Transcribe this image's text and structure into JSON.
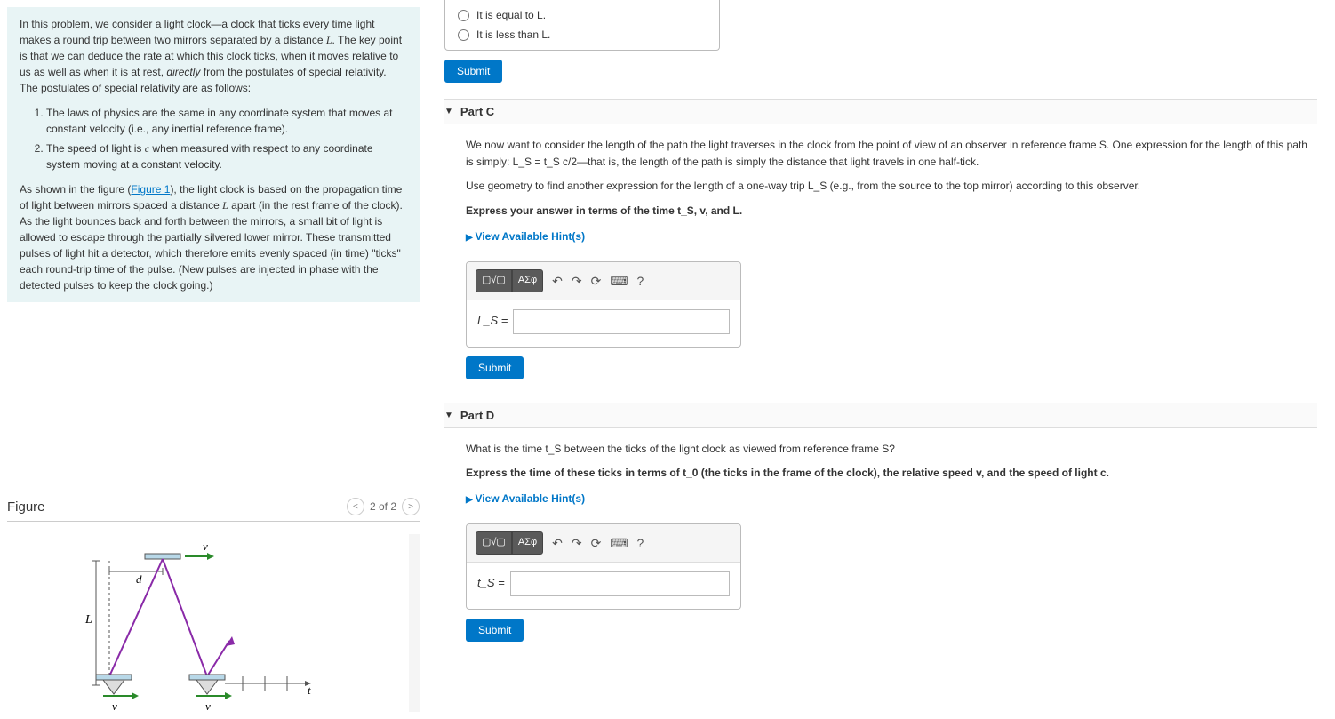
{
  "intro": {
    "p1a": "In this problem, we consider a light clock—a clock that ticks every time light makes a round trip between two mirrors separated by a distance ",
    "p1b": ". The key point is that we can deduce the rate at which this clock ticks, when it moves relative to us as well as when it is at rest, ",
    "p1c": " from the postulates of special relativity. The postulates of special relativity are as follows:",
    "p1_directly": "directly",
    "li1": "The laws of physics are the same in any coordinate system that moves at constant velocity (i.e., any inertial reference frame).",
    "li2a": "The speed of light is ",
    "li2b": " when measured with respect to any coordinate system moving at a constant velocity.",
    "p2a": "As shown in the figure (",
    "p2_link": "Figure 1",
    "p2b": "), the light clock is based on the propagation time of light between mirrors spaced a distance ",
    "p2c": " apart (in the rest frame of the clock). As the light bounces back and forth between the mirrors, a small bit of light is allowed to escape through the partially silvered lower mirror. These transmitted pulses of light hit a detector, which therefore emits evenly spaced (in time) \"ticks\" each round-trip time of the pulse. (New pulses are injected in phase with the detected pulses to keep the clock going.)",
    "varL": "L",
    "varc": "c"
  },
  "figure": {
    "title": "Figure",
    "pager": "2 of 2"
  },
  "partPrev": {
    "opt1": "It is equal to L.",
    "opt2": "It is less than L.",
    "submit": "Submit"
  },
  "partC": {
    "title": "Part C",
    "p1": "We now want to consider the length of the path the light traverses in the clock from the point of view of an observer in reference frame S. One expression for the length of this path is simply: L_S = t_S c/2—that is, the length of the path is simply the distance that light travels in one half-tick.",
    "p2": "Use geometry to find another expression for the length of a one-way trip L_S (e.g., from the source to the top mirror) according to this observer.",
    "instruct": "Express your answer in terms of the time t_S, v, and L.",
    "hints": "View Available Hint(s)",
    "label": "L_S =",
    "submit": "Submit"
  },
  "partD": {
    "title": "Part D",
    "p1": "What is the time t_S between the ticks of the light clock as viewed from reference frame S?",
    "instruct": "Express the time of these ticks in terms of t_0 (the ticks in the frame of the clock), the relative speed v, and the speed of light c.",
    "hints": "View Available Hint(s)",
    "label": "t_S =",
    "submit": "Submit"
  },
  "toolbar": {
    "templates": "▢√▢",
    "greek": "ΑΣφ",
    "undo": "↶",
    "redo": "↷",
    "reset": "⟳",
    "keyboard": "⌨",
    "help": "?"
  }
}
